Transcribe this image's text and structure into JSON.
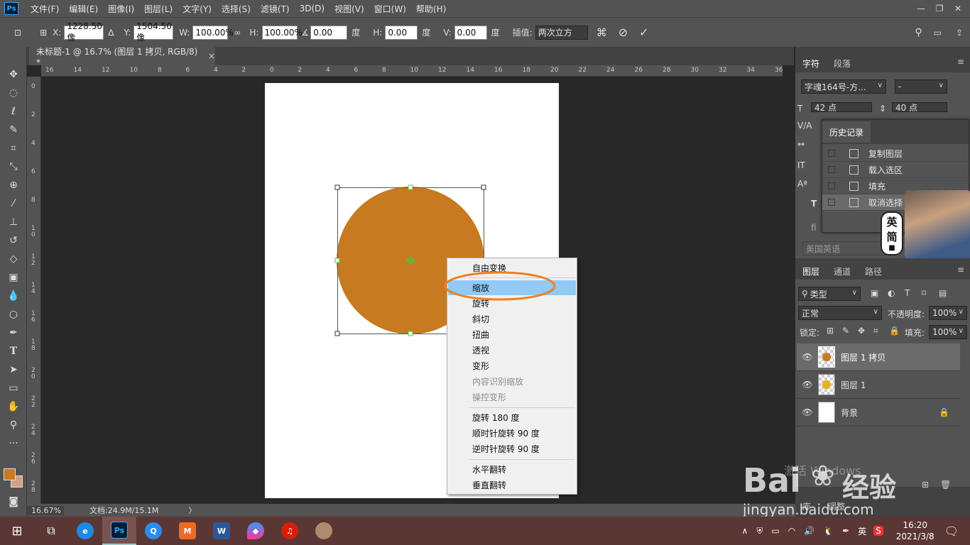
{
  "app": {
    "logo": "Ps"
  },
  "menubar": {
    "items": [
      "文件(F)",
      "编辑(E)",
      "图像(I)",
      "图层(L)",
      "文字(Y)",
      "选择(S)",
      "滤镜(T)",
      "3D(D)",
      "视图(V)",
      "窗口(W)",
      "帮助(H)"
    ]
  },
  "options": {
    "x_label": "X:",
    "x_value": "1228.50 像",
    "y_label": "Y:",
    "y_value": "1504.50 像",
    "w_label": "W:",
    "w_value": "100.00%",
    "h_label": "H:",
    "h_value": "100.00%",
    "angle_value": "0.00",
    "angle_unit": "度",
    "hskew_label": "H:",
    "hskew_value": "0.00",
    "hskew_unit": "度",
    "vskew_label": "V:",
    "vskew_value": "0.00",
    "vskew_unit": "度",
    "interp_label": "插值:",
    "interp_value": "两次立方"
  },
  "document_tab": {
    "title": "未标题-1 @ 16.7% (图层 1 拷贝, RGB/8) *",
    "close": "×"
  },
  "ruler": {
    "h_ticks": [
      "16",
      "14",
      "12",
      "10",
      "8",
      "6",
      "4",
      "2",
      "0",
      "2",
      "4",
      "6",
      "8",
      "10",
      "12",
      "14",
      "16",
      "18",
      "20",
      "22",
      "24",
      "26",
      "28",
      "30",
      "32",
      "34",
      "36"
    ],
    "v_ticks": [
      "0",
      "2",
      "4",
      "6",
      "8",
      "1 0",
      "1 2",
      "1 4",
      "1 6",
      "1 8",
      "2 0",
      "2 2",
      "2 4",
      "2 6",
      "2 8"
    ]
  },
  "context_menu": {
    "items": [
      {
        "label": "自由变换",
        "disabled": false
      },
      {
        "label": "缩放",
        "disabled": false,
        "selected": true
      },
      {
        "label": "旋转",
        "disabled": false
      },
      {
        "label": "斜切",
        "disabled": false
      },
      {
        "label": "扭曲",
        "disabled": false
      },
      {
        "label": "透视",
        "disabled": false
      },
      {
        "label": "变形",
        "disabled": false
      },
      {
        "label": "内容识别缩放",
        "disabled": true
      },
      {
        "label": "操控变形",
        "disabled": true
      },
      {
        "label": "旋转 180 度",
        "disabled": false
      },
      {
        "label": "顺时针旋转 90 度",
        "disabled": false
      },
      {
        "label": "逆时针旋转 90 度",
        "disabled": false
      },
      {
        "label": "水平翻转",
        "disabled": false
      },
      {
        "label": "垂直翻转",
        "disabled": false
      }
    ]
  },
  "status": {
    "zoom": "16.67%",
    "doc": "文档:24.9M/15.1M",
    "arrow": "〉"
  },
  "char_panel": {
    "tabs": [
      "字符",
      "段落"
    ],
    "font": "字魂164号-方...",
    "style": "-",
    "size": "42 点",
    "leading": "40 点",
    "language": "美国英语"
  },
  "history": {
    "title": "历史记录",
    "items": [
      "复制图层",
      "载入选区",
      "填充",
      "取消选择"
    ]
  },
  "ime": {
    "lang1": "英",
    "lang2": "简"
  },
  "layers": {
    "tabs": [
      "图层",
      "通道",
      "路径"
    ],
    "filter": "类型",
    "blend": "正常",
    "opacity_label": "不透明度:",
    "opacity": "100%",
    "lock_label": "锁定:",
    "fill_label": "填充:",
    "fill": "100%",
    "rows": [
      {
        "name": "图层 1 拷贝",
        "dot_color": "#c87a21"
      },
      {
        "name": "图层 1",
        "dot_color": "#e8b020"
      },
      {
        "name": "背景"
      }
    ]
  },
  "watermark": {
    "line1": "激活 Windows",
    "brand": "Bai",
    "brand2": "经验",
    "url": "jingyan.baidu.com"
  },
  "bottom_panel": {
    "tabs": [
      "库",
      "调整"
    ]
  },
  "taskbar": {
    "time": "16:20",
    "date": "2021/3/8",
    "ime": "英"
  },
  "colors": {
    "circle": "#c87a21",
    "highlight": "#91c9f7",
    "annotation": "#f07f22",
    "fg": "#c87a21",
    "bg": "#d2a080"
  }
}
